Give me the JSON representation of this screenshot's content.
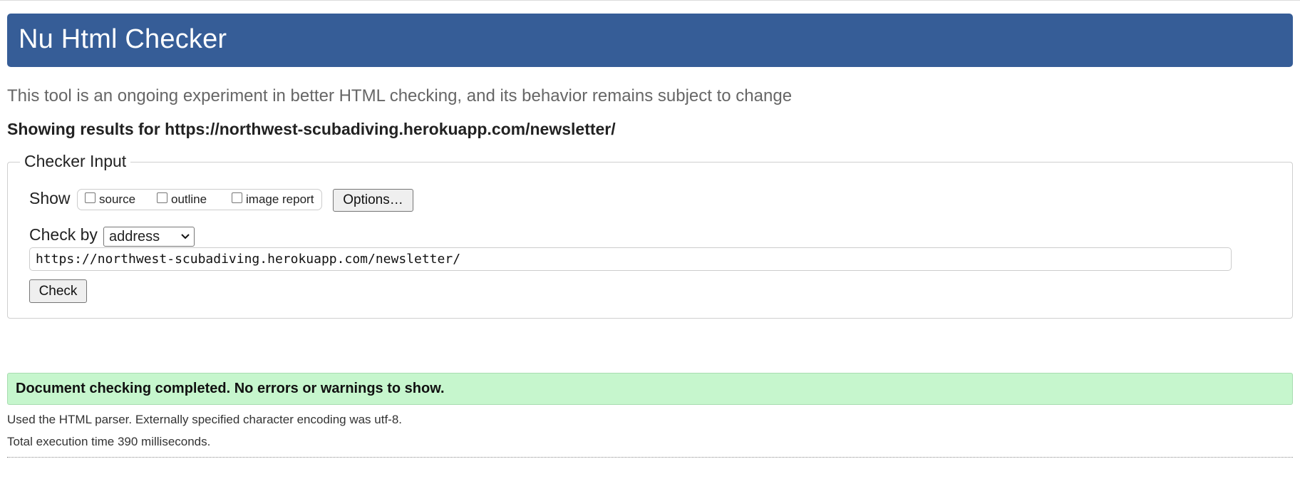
{
  "header": {
    "title": "Nu Html Checker"
  },
  "intro": "This tool is an ongoing experiment in better HTML checking, and its behavior remains subject to change",
  "results_heading": "Showing results for https://northwest-scubadiving.herokuapp.com/newsletter/",
  "checker_input": {
    "legend": "Checker Input",
    "show_label": "Show",
    "show_options": [
      {
        "label": "source",
        "checked": false
      },
      {
        "label": "outline",
        "checked": false
      },
      {
        "label": "image report",
        "checked": false
      }
    ],
    "options_button": "Options…",
    "check_by_label": "Check by",
    "check_by_selected": "address",
    "url_value": "https://northwest-scubadiving.herokuapp.com/newsletter/",
    "check_button": "Check"
  },
  "result": {
    "message": "Document checking completed. No errors or warnings to show.",
    "parser_info": "Used the HTML parser. Externally specified character encoding was utf-8.",
    "execution_time": "Total execution time 390 milliseconds."
  },
  "colors": {
    "header_bg": "#365d97",
    "success_bg": "#c6f6cd",
    "intro_text": "#666666"
  },
  "icons": {
    "select_arrow": "chevron-down-icon"
  }
}
